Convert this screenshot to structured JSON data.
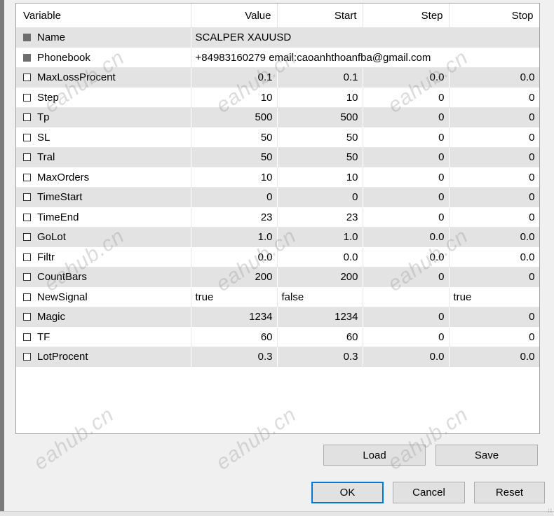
{
  "columns": {
    "variable": "Variable",
    "value": "Value",
    "start": "Start",
    "step": "Step",
    "stop": "Stop"
  },
  "rows": [
    {
      "name": "Name",
      "value": "SCALPER XAUUSD",
      "enabled": false
    },
    {
      "name": "Phonebook",
      "value": "+84983160279   email:caoanhthoanfba@gmail.com",
      "enabled": false
    },
    {
      "name": "MaxLossProcent",
      "value": "0.1",
      "start": "0.1",
      "step": "0.0",
      "stop": "0.0"
    },
    {
      "name": "Step",
      "value": "10",
      "start": "10",
      "step": "0",
      "stop": "0"
    },
    {
      "name": "Tp",
      "value": "500",
      "start": "500",
      "step": "0",
      "stop": "0"
    },
    {
      "name": "SL",
      "value": "50",
      "start": "50",
      "step": "0",
      "stop": "0"
    },
    {
      "name": "Tral",
      "value": "50",
      "start": "50",
      "step": "0",
      "stop": "0"
    },
    {
      "name": "MaxOrders",
      "value": "10",
      "start": "10",
      "step": "0",
      "stop": "0"
    },
    {
      "name": "TimeStart",
      "value": "0",
      "start": "0",
      "step": "0",
      "stop": "0"
    },
    {
      "name": "TimeEnd",
      "value": "23",
      "start": "23",
      "step": "0",
      "stop": "0"
    },
    {
      "name": "GoLot",
      "value": "1.0",
      "start": "1.0",
      "step": "0.0",
      "stop": "0.0"
    },
    {
      "name": "Filtr",
      "value": "0.0",
      "start": "0.0",
      "step": "0.0",
      "stop": "0.0"
    },
    {
      "name": "CountBars",
      "value": "200",
      "start": "200",
      "step": "0",
      "stop": "0"
    },
    {
      "name": "NewSignal",
      "value": "true",
      "start": "false",
      "step": "",
      "stop": "true"
    },
    {
      "name": "Magic",
      "value": "1234",
      "start": "1234",
      "step": "0",
      "stop": "0"
    },
    {
      "name": "TF",
      "value": "60",
      "start": "60",
      "step": "0",
      "stop": "0"
    },
    {
      "name": "LotProcent",
      "value": "0.3",
      "start": "0.3",
      "step": "0.0",
      "stop": "0.0"
    }
  ],
  "buttons": {
    "load": "Load",
    "save": "Save",
    "ok": "OK",
    "cancel": "Cancel",
    "reset": "Reset"
  },
  "watermark": "eahub.cn",
  "colors": {
    "row_shade": "#e3e3e3",
    "focus_border": "#0078d7",
    "button_face": "#e1e1e1"
  }
}
